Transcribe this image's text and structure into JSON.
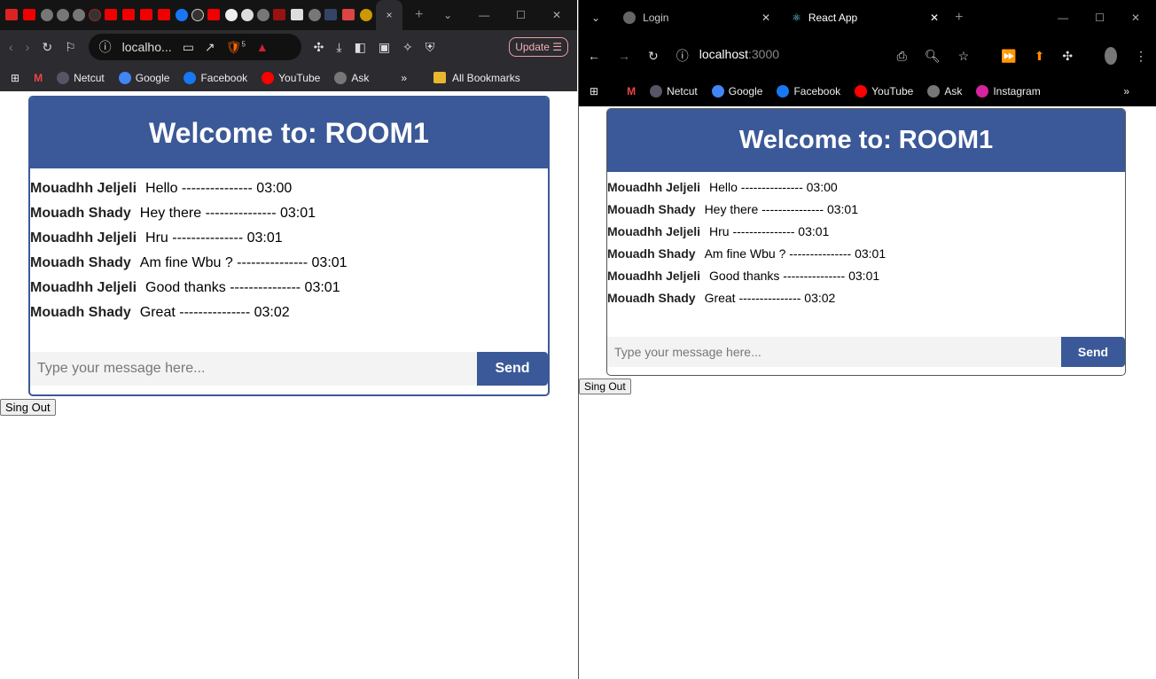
{
  "left": {
    "tab_close": "×",
    "new_tab": "+",
    "url": "localho...",
    "shields_count": "5",
    "update_label": "Update",
    "bookmarks": [
      {
        "label": "Netcut"
      },
      {
        "label": "Google"
      },
      {
        "label": "Facebook"
      },
      {
        "label": "YouTube"
      },
      {
        "label": "Ask"
      }
    ],
    "bookmarks_more": "»",
    "all_bookmarks": "All Bookmarks"
  },
  "right": {
    "tabs": [
      {
        "label": "Login"
      },
      {
        "label": "React App"
      }
    ],
    "url_host": "localhost",
    "url_port": ":3000",
    "bookmarks": [
      {
        "label": "Netcut"
      },
      {
        "label": "Google"
      },
      {
        "label": "Facebook"
      },
      {
        "label": "YouTube"
      },
      {
        "label": "Ask"
      },
      {
        "label": "Instagram"
      }
    ],
    "bookmarks_more": "»"
  },
  "chat": {
    "title": "Welcome to: ROOM1",
    "messages": [
      {
        "author": "Mouadhh Jeljeli",
        "text": "Hello --------------- 03:00"
      },
      {
        "author": "Mouadh Shady",
        "text": "Hey there --------------- 03:01"
      },
      {
        "author": "Mouadhh Jeljeli",
        "text": "Hru --------------- 03:01"
      },
      {
        "author": "Mouadh Shady",
        "text": "Am fine Wbu ? --------------- 03:01"
      },
      {
        "author": "Mouadhh Jeljeli",
        "text": "Good thanks --------------- 03:01"
      },
      {
        "author": "Mouadh Shady",
        "text": "Great --------------- 03:02"
      }
    ],
    "placeholder": "Type your message here...",
    "send_label": "Send",
    "signout_label": "Sing Out"
  },
  "colors": {
    "brand": "#3b5998"
  }
}
